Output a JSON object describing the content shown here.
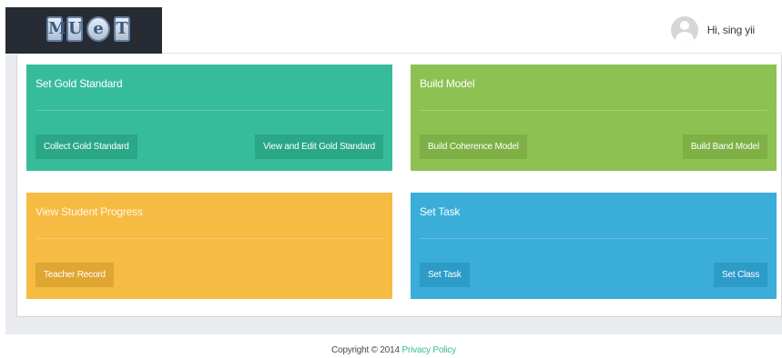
{
  "header": {
    "logo_letters": [
      "M",
      "U",
      "e",
      "T"
    ],
    "greeting": "Hi, sing yii"
  },
  "cards": [
    {
      "title": "Set Gold Standard",
      "color": "#37bc9b",
      "buttons": [
        "Collect Gold Standard",
        "View and Edit Gold Standard"
      ]
    },
    {
      "title": "Build Model",
      "color": "#8dc152",
      "buttons": [
        "Build Coherence Model",
        "Build Band Model"
      ]
    },
    {
      "title": "View Student Progress",
      "color": "#f6bb43",
      "buttons": [
        "Teacher Record"
      ]
    },
    {
      "title": "Set Task",
      "color": "#3aadd9",
      "buttons": [
        "Set Task",
        "Set Class"
      ]
    }
  ],
  "footer": {
    "copyright": "Copyright © 2014",
    "privacy_link": "Privacy Policy",
    "link_color": "#37bc9b"
  }
}
